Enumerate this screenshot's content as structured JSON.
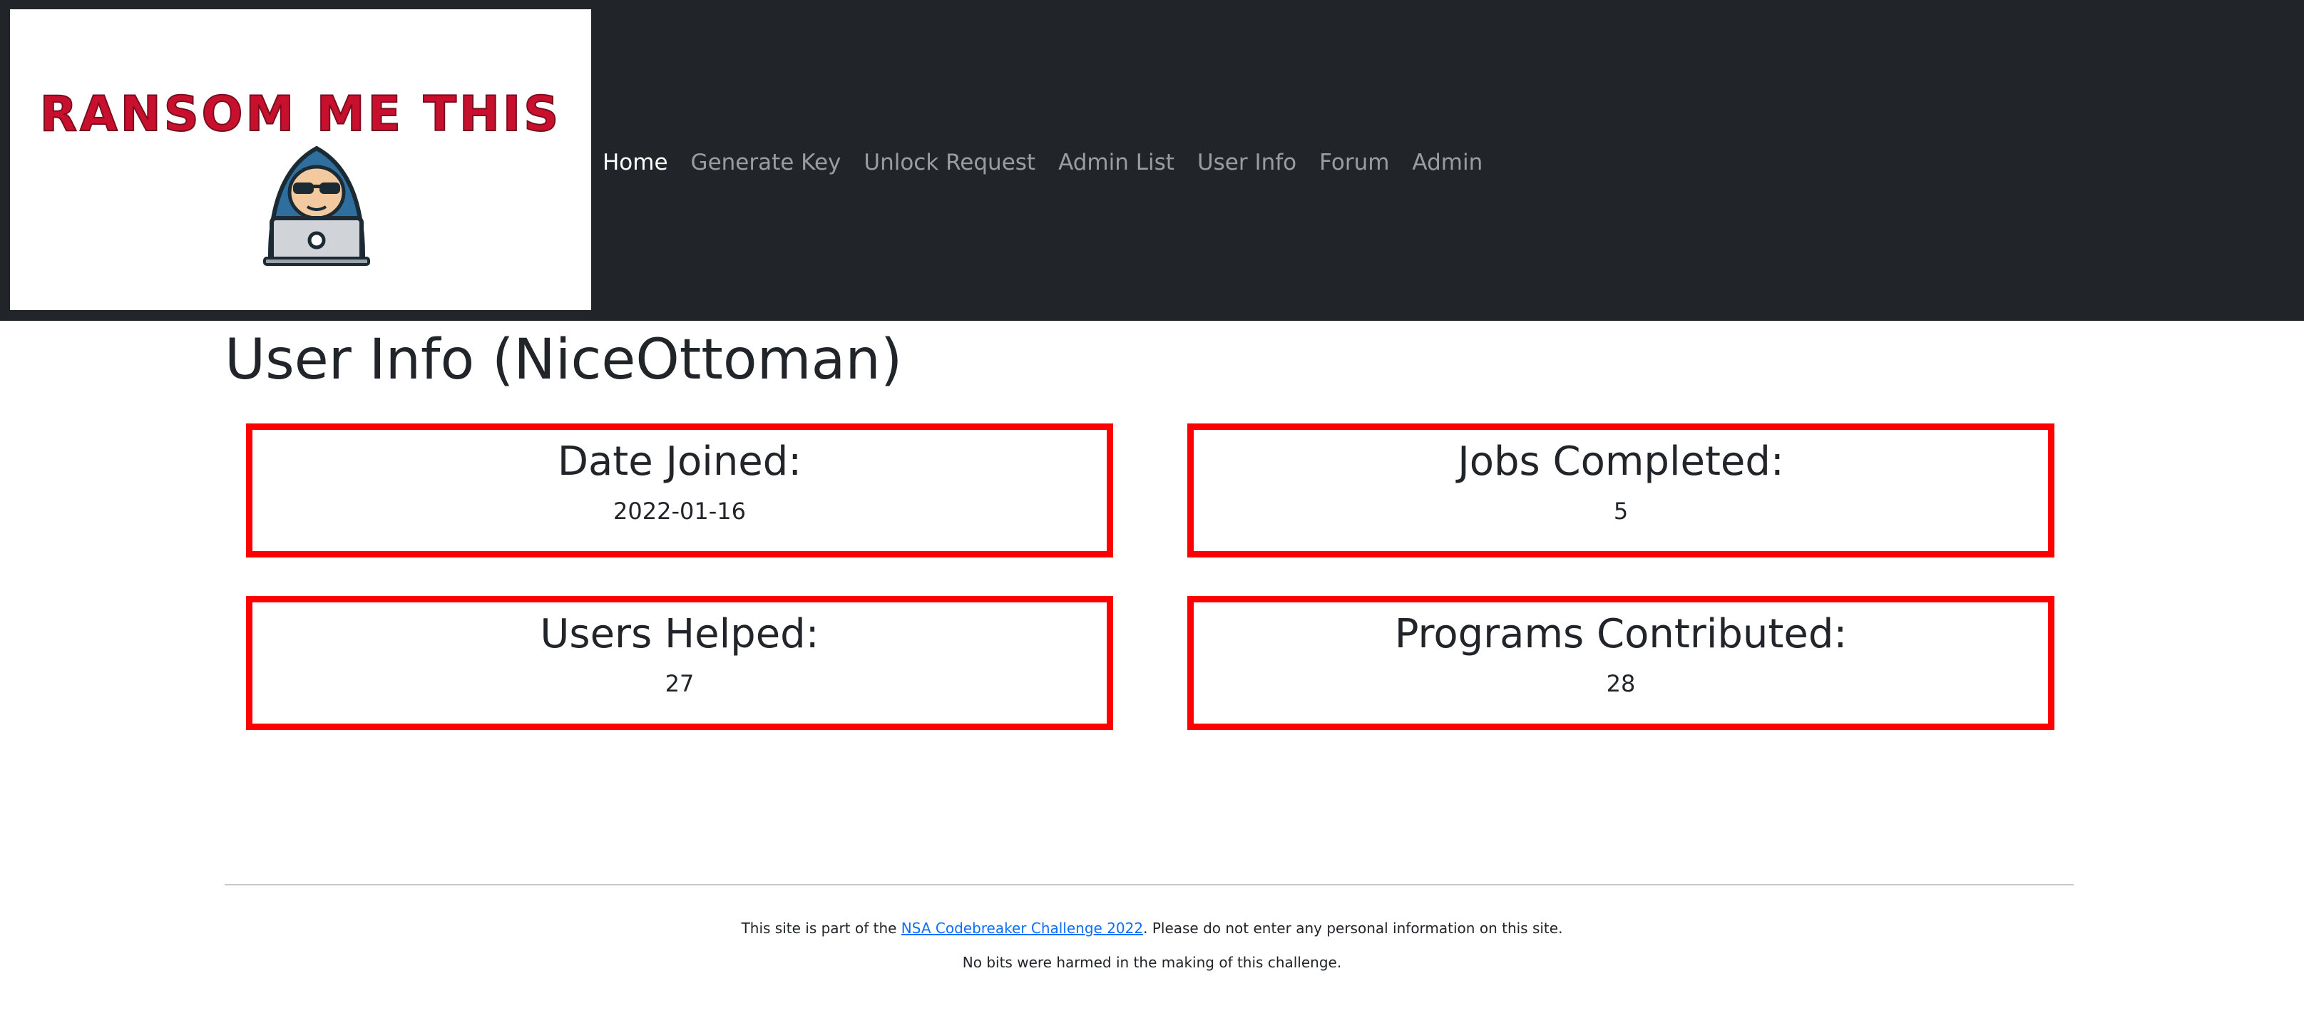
{
  "logo": {
    "text": "RANSOM ME THIS",
    "icon": "hacker-laptop-icon"
  },
  "nav": {
    "items": [
      {
        "label": "Home",
        "active": true
      },
      {
        "label": "Generate Key",
        "active": false
      },
      {
        "label": "Unlock Request",
        "active": false
      },
      {
        "label": "Admin List",
        "active": false
      },
      {
        "label": "User Info",
        "active": false
      },
      {
        "label": "Forum",
        "active": false
      },
      {
        "label": "Admin",
        "active": false
      }
    ]
  },
  "page": {
    "title": "User Info (NiceOttoman)"
  },
  "stats": [
    {
      "label": "Date Joined:",
      "value": "2022-01-16"
    },
    {
      "label": "Jobs Completed:",
      "value": "5"
    },
    {
      "label": "Users Helped:",
      "value": "27"
    },
    {
      "label": "Programs Contributed:",
      "value": "28"
    }
  ],
  "footer": {
    "line1_prefix": "This site is part of the ",
    "line1_link": "NSA Codebreaker Challenge 2022",
    "line1_suffix": ". Please do not enter any personal information on this site.",
    "line2": "No bits were harmed in the making of this challenge."
  },
  "colors": {
    "navbar_bg": "#212529",
    "card_border": "#ff0000",
    "logo_red": "#c8102e",
    "link": "#0d6efd"
  }
}
